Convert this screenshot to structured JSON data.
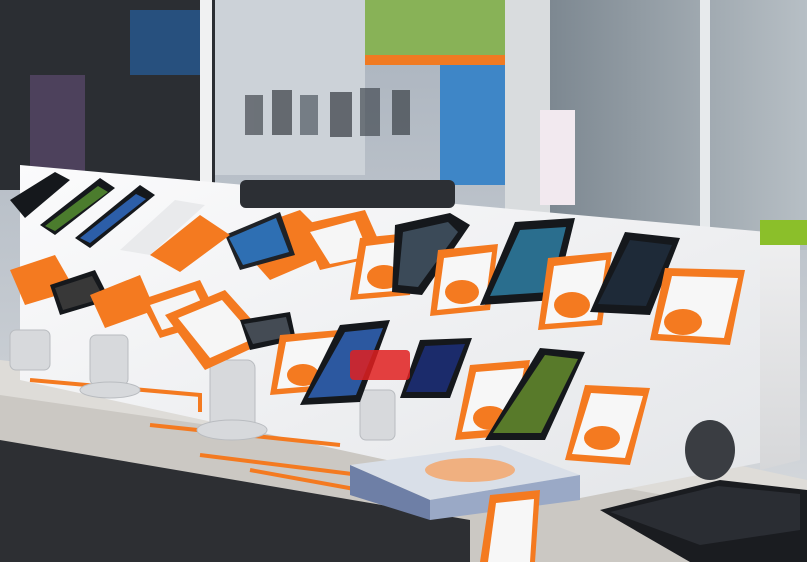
{
  "colors": {
    "accent": "#f47a20",
    "display_top": "#f4f5f6",
    "display_front": "#e9eaec",
    "counter": "#e8e6e2",
    "background": "#c9ccd0"
  },
  "phones_top_row": [
    {
      "screen": "#2e6fb3"
    },
    {
      "screen": "#3b4a58"
    },
    {
      "screen": "#2a6e8e"
    },
    {
      "screen": "#1e2a38"
    },
    {
      "screen": "#4b7c2d"
    },
    {
      "screen": "#2c5ea8"
    },
    {
      "screen": "#383838"
    },
    {
      "screen": "#5e7b93"
    }
  ],
  "phones_bottom_row": [
    {
      "screen": "#444b54"
    },
    {
      "screen": "#2c58a0"
    },
    {
      "screen": "#1b2b6b"
    },
    {
      "screen": "#587a2a"
    },
    {
      "screen": "#4b5a68"
    }
  ]
}
